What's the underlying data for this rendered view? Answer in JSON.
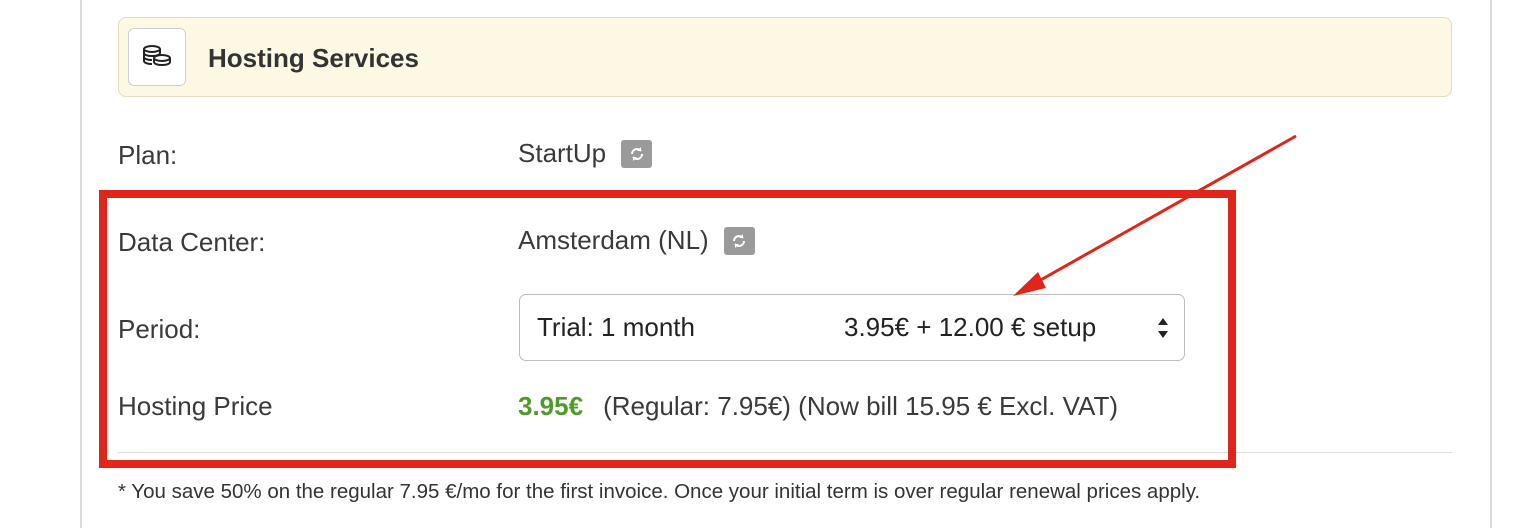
{
  "header": {
    "title": "Hosting Services",
    "icon": "coins-stack-icon"
  },
  "rows": {
    "plan": {
      "label": "Plan:",
      "value": "StartUp"
    },
    "data_center": {
      "label": "Data Center:",
      "value": "Amsterdam (NL)"
    },
    "period": {
      "label": "Period:",
      "selected_term": "Trial: 1 month",
      "selected_price": "3.95€ + 12.00 € setup"
    },
    "hosting_price": {
      "label": "Hosting Price",
      "price": "3.95€",
      "details": "(Regular: 7.95€) (Now bill 15.95 € Excl. VAT)"
    }
  },
  "footnote": "* You save 50% on the regular 7.95 €/mo for the first invoice. Once your initial term is over regular renewal prices apply.",
  "annotation": {
    "color": "#e0261b",
    "type": "red-highlight-box-with-arrow"
  },
  "colors": {
    "header_bg": "#fcf8e3",
    "price_green": "#4f9a2b",
    "button_gray": "#9a9a9a"
  }
}
